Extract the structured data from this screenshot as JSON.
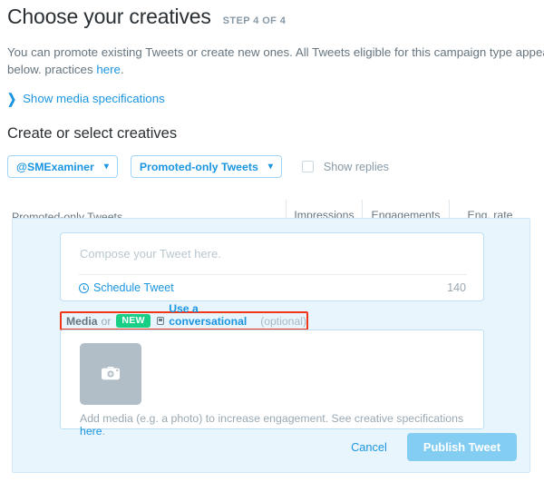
{
  "header": {
    "title": "Choose your creatives",
    "step": "STEP 4 OF 4"
  },
  "intro": {
    "text_before_link": "You can promote existing Tweets or create new ones. All Tweets eligible for this campaign type appear below. practices ",
    "link_text": "here",
    "text_after_link": "."
  },
  "show_specs": {
    "icon": "chevron-right-icon",
    "label": "Show media specifications"
  },
  "section": {
    "heading": "Create or select creatives"
  },
  "filters": {
    "account_select": "@SMExaminer",
    "account_caret": "⌄",
    "tweet_type_select": "Promoted-only Tweets",
    "tweet_type_caret": "⌄",
    "show_replies_label": "Show replies"
  },
  "table": {
    "main_column": "Promoted-only Tweets",
    "metrics": [
      "Impressions",
      "Engagements",
      "Eng. rate"
    ]
  },
  "compose": {
    "placeholder": "Compose your Tweet here.",
    "schedule_label": "Schedule Tweet",
    "char_count": "140"
  },
  "media_row": {
    "media_word": "Media",
    "or_word": "or",
    "new_badge": "NEW",
    "card_icon": "conversational-card-icon",
    "conversational_link": "Use a conversational card",
    "optional": "(optional)",
    "highlight_color": "#f1371a"
  },
  "media_upload": {
    "thumb_icon": "camera-add-icon",
    "hint_before_link": "Add media (e.g. a photo) to increase engagement. See creative specifications ",
    "hint_link": "here",
    "hint_after_link": "."
  },
  "footer": {
    "cancel_label": "Cancel",
    "publish_label": "Publish Tweet"
  },
  "colors": {
    "accent_blue": "#1b95e0",
    "panel_bg": "#e8f5fd",
    "badge_green": "#19cf86",
    "highlight_red": "#f1371a",
    "publish_disabled": "#84cdf2"
  }
}
